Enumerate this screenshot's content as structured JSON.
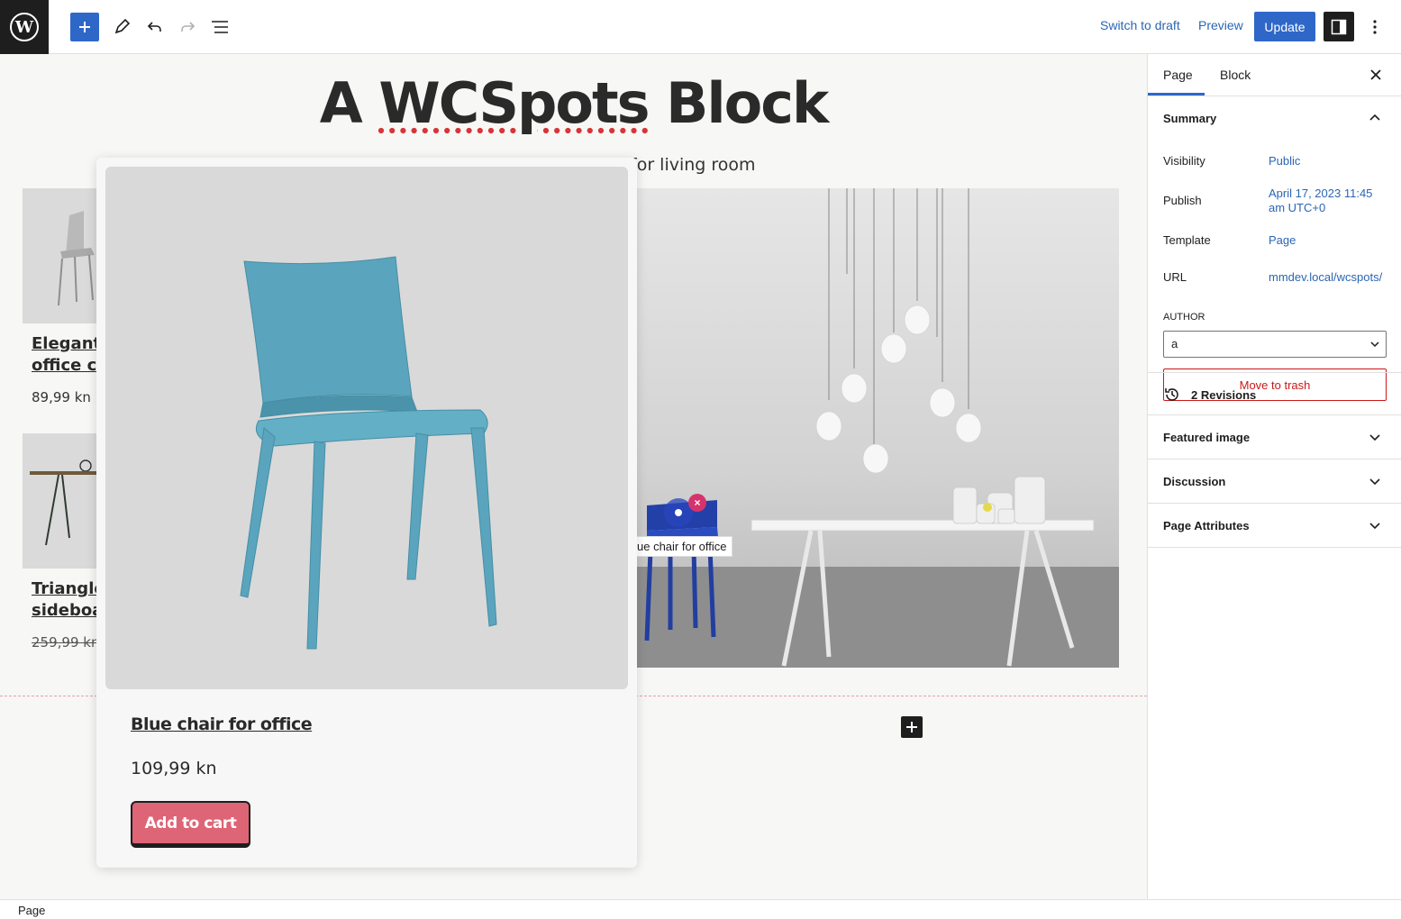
{
  "toolbar": {
    "switch_draft": "Switch to draft",
    "preview": "Preview",
    "update": "Update"
  },
  "editor": {
    "title_part1": "A ",
    "title_squiggle": "WCSpots",
    "title_part2": " Block",
    "subtitle": "for living room",
    "products": [
      {
        "name_line1": "Elegant v",
        "name_line2": "office ch",
        "price": "89,99 kn"
      },
      {
        "name_line1": "Triangle",
        "name_line2": "sideboar",
        "price": "259,99 kn"
      }
    ],
    "hotspot_label": "ue chair for office",
    "hotspot_close": "×"
  },
  "popover": {
    "title": "Blue chair for office",
    "price": "109,99 kn",
    "add_to_cart": "Add to cart"
  },
  "sidebar": {
    "tabs": [
      "Page",
      "Block"
    ],
    "summary_label": "Summary",
    "rows": [
      {
        "label": "Visibility",
        "value": "Public"
      },
      {
        "label": "Publish",
        "value": "April 17, 2023 11:45 am UTC+0"
      },
      {
        "label": "Template",
        "value": "Page"
      },
      {
        "label": "URL",
        "value": "mmdev.local/wcspots/"
      }
    ],
    "author_label": "AUTHOR",
    "author_value": "a",
    "move_to_trash": "Move to trash",
    "revisions": "2 Revisions",
    "featured_image": "Featured image",
    "discussion": "Discussion",
    "page_attributes": "Page Attributes"
  },
  "footer": {
    "breadcrumb": "Page"
  },
  "colors": {
    "accent": "#2f67c8",
    "add_to_cart": "#dd6575",
    "chair": "#5aa5bd",
    "danger": "#cc1818"
  }
}
